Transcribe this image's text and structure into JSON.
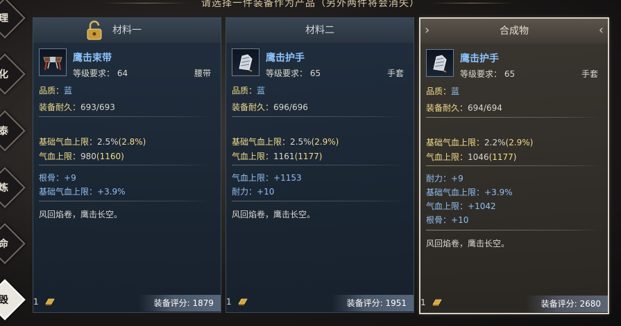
{
  "banner": "请选择一件装备作为产品（另外两件将会消失）",
  "left_tabs": [
    "理",
    "化",
    "泰",
    "炼",
    "命",
    "毁"
  ],
  "cards": [
    {
      "header": "材料一",
      "item_name": "鹰击束带",
      "req_label": "等级要求：",
      "req_value": "64",
      "slot": "腰带",
      "quality_label": "品质：",
      "quality_value": "蓝",
      "durability_label": "装备耐久：",
      "durability_value": "693/693",
      "base_stats": [
        {
          "label": "基础气血上限：",
          "value": "2.5%",
          "extra": "(2.8%)"
        },
        {
          "label": "气血上限：",
          "value": "980",
          "extra": "(1160)"
        }
      ],
      "bonus_stats": [
        {
          "label": "根骨：",
          "value": "+9"
        },
        {
          "label": "基础气血上限：",
          "value": "+3.9%"
        }
      ],
      "effect": "风回焰卷，鹰击长空。",
      "count": "1",
      "score_label": "装备评分:",
      "score_value": "1879"
    },
    {
      "header": "材料二",
      "item_name": "鹰击护手",
      "req_label": "等级要求：",
      "req_value": "65",
      "slot": "手套",
      "quality_label": "品质：",
      "quality_value": "蓝",
      "durability_label": "装备耐久：",
      "durability_value": "696/696",
      "base_stats": [
        {
          "label": "基础气血上限：",
          "value": "2.5%",
          "extra": "(2.9%)"
        },
        {
          "label": "气血上限：",
          "value": "1161",
          "extra": "(1177)"
        }
      ],
      "bonus_stats": [
        {
          "label": "气血上限：",
          "value": "+1153"
        },
        {
          "label": "耐力：",
          "value": "+10"
        }
      ],
      "effect": "风回焰卷，鹰击长空。",
      "count": "1",
      "score_label": "装备评分:",
      "score_value": "1951"
    },
    {
      "header": "合成物",
      "item_name": "鹰击护手",
      "req_label": "等级要求：",
      "req_value": "65",
      "slot": "手套",
      "quality_label": "品质：",
      "quality_value": "蓝",
      "durability_label": "装备耐久：",
      "durability_value": "694/694",
      "base_stats": [
        {
          "label": "基础气血上限：",
          "value": "2.2%",
          "extra": "(2.9%)"
        },
        {
          "label": "气血上限：",
          "value": "1046",
          "extra": "(1177)"
        }
      ],
      "bonus_stats": [
        {
          "label": "耐力：",
          "value": "+9"
        },
        {
          "label": "基础气血上限：",
          "value": "+3.9%"
        },
        {
          "label": "气血上限：",
          "value": "+1042"
        },
        {
          "label": "根骨：",
          "value": "+10"
        }
      ],
      "effect": "风回焰卷，鹰击长空。",
      "count": "1",
      "score_label": "装备评分:",
      "score_value": "2680"
    }
  ]
}
